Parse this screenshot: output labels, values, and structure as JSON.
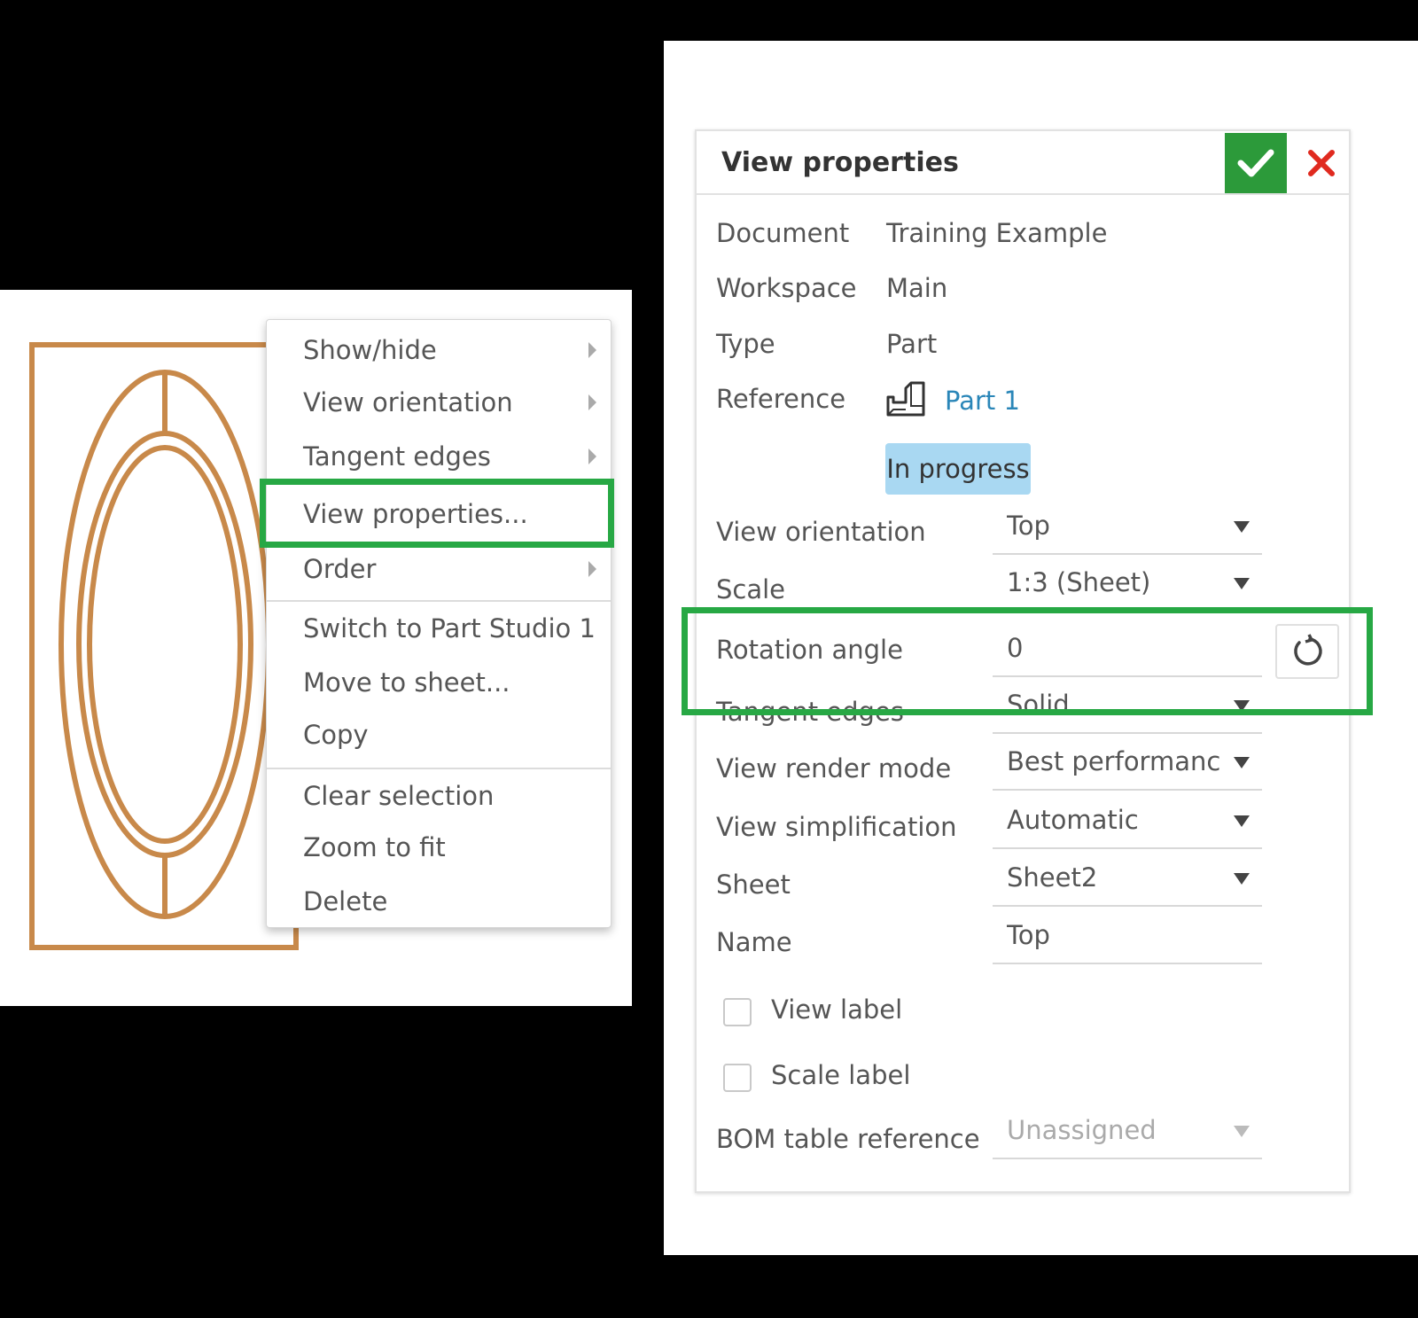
{
  "context_menu": {
    "items": [
      {
        "label": "Show/hide",
        "submenu": true
      },
      {
        "label": "View orientation",
        "submenu": true
      },
      {
        "label": "Tangent edges",
        "submenu": true
      },
      {
        "label": "View properties...",
        "submenu": false
      },
      {
        "label": "Order",
        "submenu": true
      },
      {
        "label": "Switch to Part Studio 1",
        "submenu": false
      },
      {
        "label": "Move to sheet...",
        "submenu": false
      },
      {
        "label": "Copy",
        "submenu": false
      },
      {
        "label": "Clear selection",
        "submenu": false
      },
      {
        "label": "Zoom to fit",
        "submenu": false
      },
      {
        "label": "Delete",
        "submenu": false
      }
    ]
  },
  "dialog": {
    "title": "View properties",
    "confirm_icon": "check-icon",
    "cancel_icon": "close-icon",
    "document_label": "Document",
    "document_value": "Training Example",
    "workspace_label": "Workspace",
    "workspace_value": "Main",
    "type_label": "Type",
    "type_value": "Part",
    "reference_label": "Reference",
    "reference_value": "Part 1",
    "reference_icon": "part-icon",
    "status_badge": "In progress",
    "view_orientation_label": "View orientation",
    "view_orientation_value": "Top",
    "scale_label": "Scale",
    "scale_value": "1:3 (Sheet)",
    "rotation_angle_label": "Rotation angle",
    "rotation_angle_value": "0",
    "reset_icon": "rotate-reset-icon",
    "tangent_edges_label": "Tangent edges",
    "tangent_edges_value": "Solid",
    "view_render_mode_label": "View render mode",
    "view_render_mode_value": "Best performanc",
    "view_simplification_label": "View simplification",
    "view_simplification_value": "Automatic",
    "sheet_label": "Sheet",
    "sheet_value": "Sheet2",
    "name_label": "Name",
    "name_value": "Top",
    "view_label_checkbox": "View label",
    "scale_label_checkbox": "Scale label",
    "bom_label": "BOM table reference",
    "bom_value": "Unassigned"
  },
  "colors": {
    "drawing_stroke": "#c8894a",
    "highlight": "#27a844",
    "confirm_bg": "#2c9a3a",
    "cancel_x": "#e02a1f",
    "link": "#2a86b8",
    "badge_bg": "#a9d8f2"
  }
}
